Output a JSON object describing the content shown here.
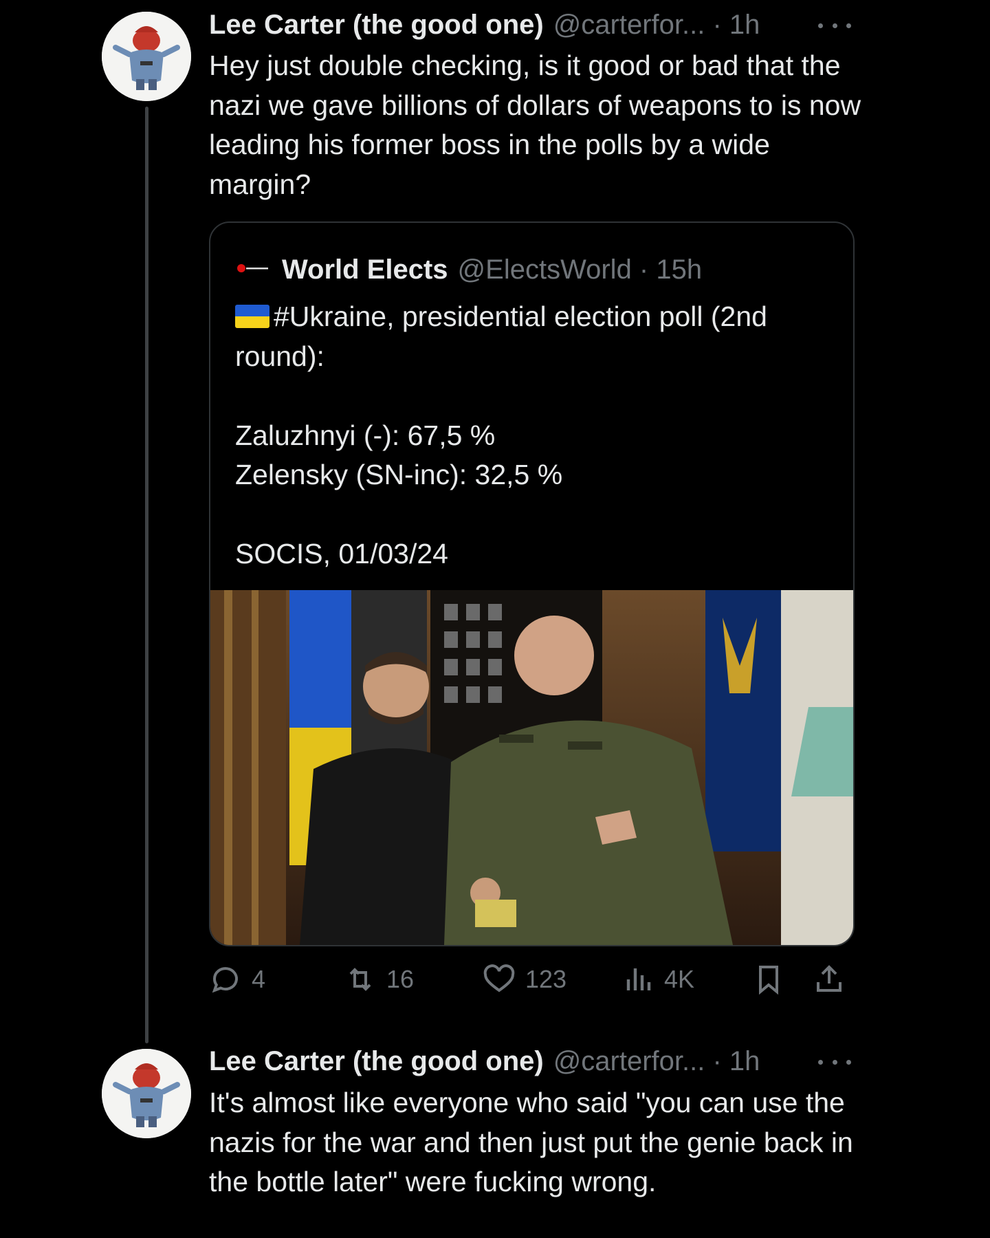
{
  "tweet1": {
    "name": "Lee Carter (the good one)",
    "handle": "@carterfor... · 1h",
    "text": "Hey just double checking, is it good or bad that the nazi we gave billions of dollars of weapons to is now leading his former boss in the polls by a wide margin?",
    "avatar_icon": "avatar-yukon-cornelius",
    "more_icon": "more-icon"
  },
  "quote": {
    "name": "World Elects",
    "handle": "@ElectsWorld · 15h",
    "text_line1": "#Ukraine, presidential election poll (2nd round):",
    "result1": "Zaluzhnyi (-): 67,5 %",
    "result2": "Zelensky (SN-inc): 32,5 %",
    "source": "SOCIS, 01/03/24",
    "flag_icon": "ukraine-flag-icon"
  },
  "actions": {
    "replies": "4",
    "reposts": "16",
    "likes": "123",
    "views": "4K"
  },
  "tweet2": {
    "name": "Lee Carter (the good one)",
    "handle": "@carterfor... · 1h",
    "text": "It's almost like everyone who said \"you can use the nazis for the war and then just put the genie back in the bottle later\" were fucking wrong."
  },
  "colors": {
    "background": "#000000",
    "text": "#e7e9ea",
    "muted": "#71767b",
    "border": "#2f3336"
  }
}
